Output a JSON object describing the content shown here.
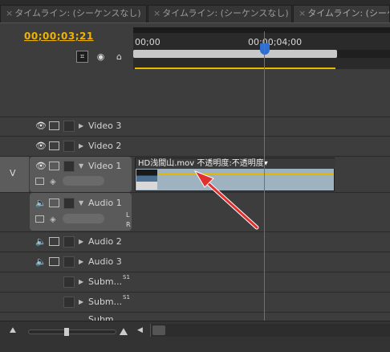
{
  "tabs": [
    {
      "label": "タイムライン: (シーケンスなし)"
    },
    {
      "label": "タイムライン: (シーケンスなし)"
    },
    {
      "label": "タイムライン: (シーケンスなし)"
    }
  ],
  "timecode": "00;00;03;21",
  "ruler": {
    "start": "00;00",
    "mark": "00;00;04;00"
  },
  "tracks": {
    "video3": "Video 3",
    "video2": "Video 2",
    "video1": "Video 1",
    "audio1": "Audio 1",
    "audio2": "Audio 2",
    "audio3": "Audio 3",
    "sub1": "Subm...",
    "sub2": "Subm...",
    "sub3": "Subm..."
  },
  "video_target": "V",
  "audio_channels": {
    "left": "L",
    "right": "R"
  },
  "submix_badge": "S1",
  "clip": {
    "name": "HD浅間山.mov",
    "opacity": "不透明度:不透明度▾"
  },
  "colors": {
    "timecode": "#f0b400",
    "playhead": "#d24a3c",
    "clip": "#9fb2c0",
    "arrow": "#e03030"
  }
}
